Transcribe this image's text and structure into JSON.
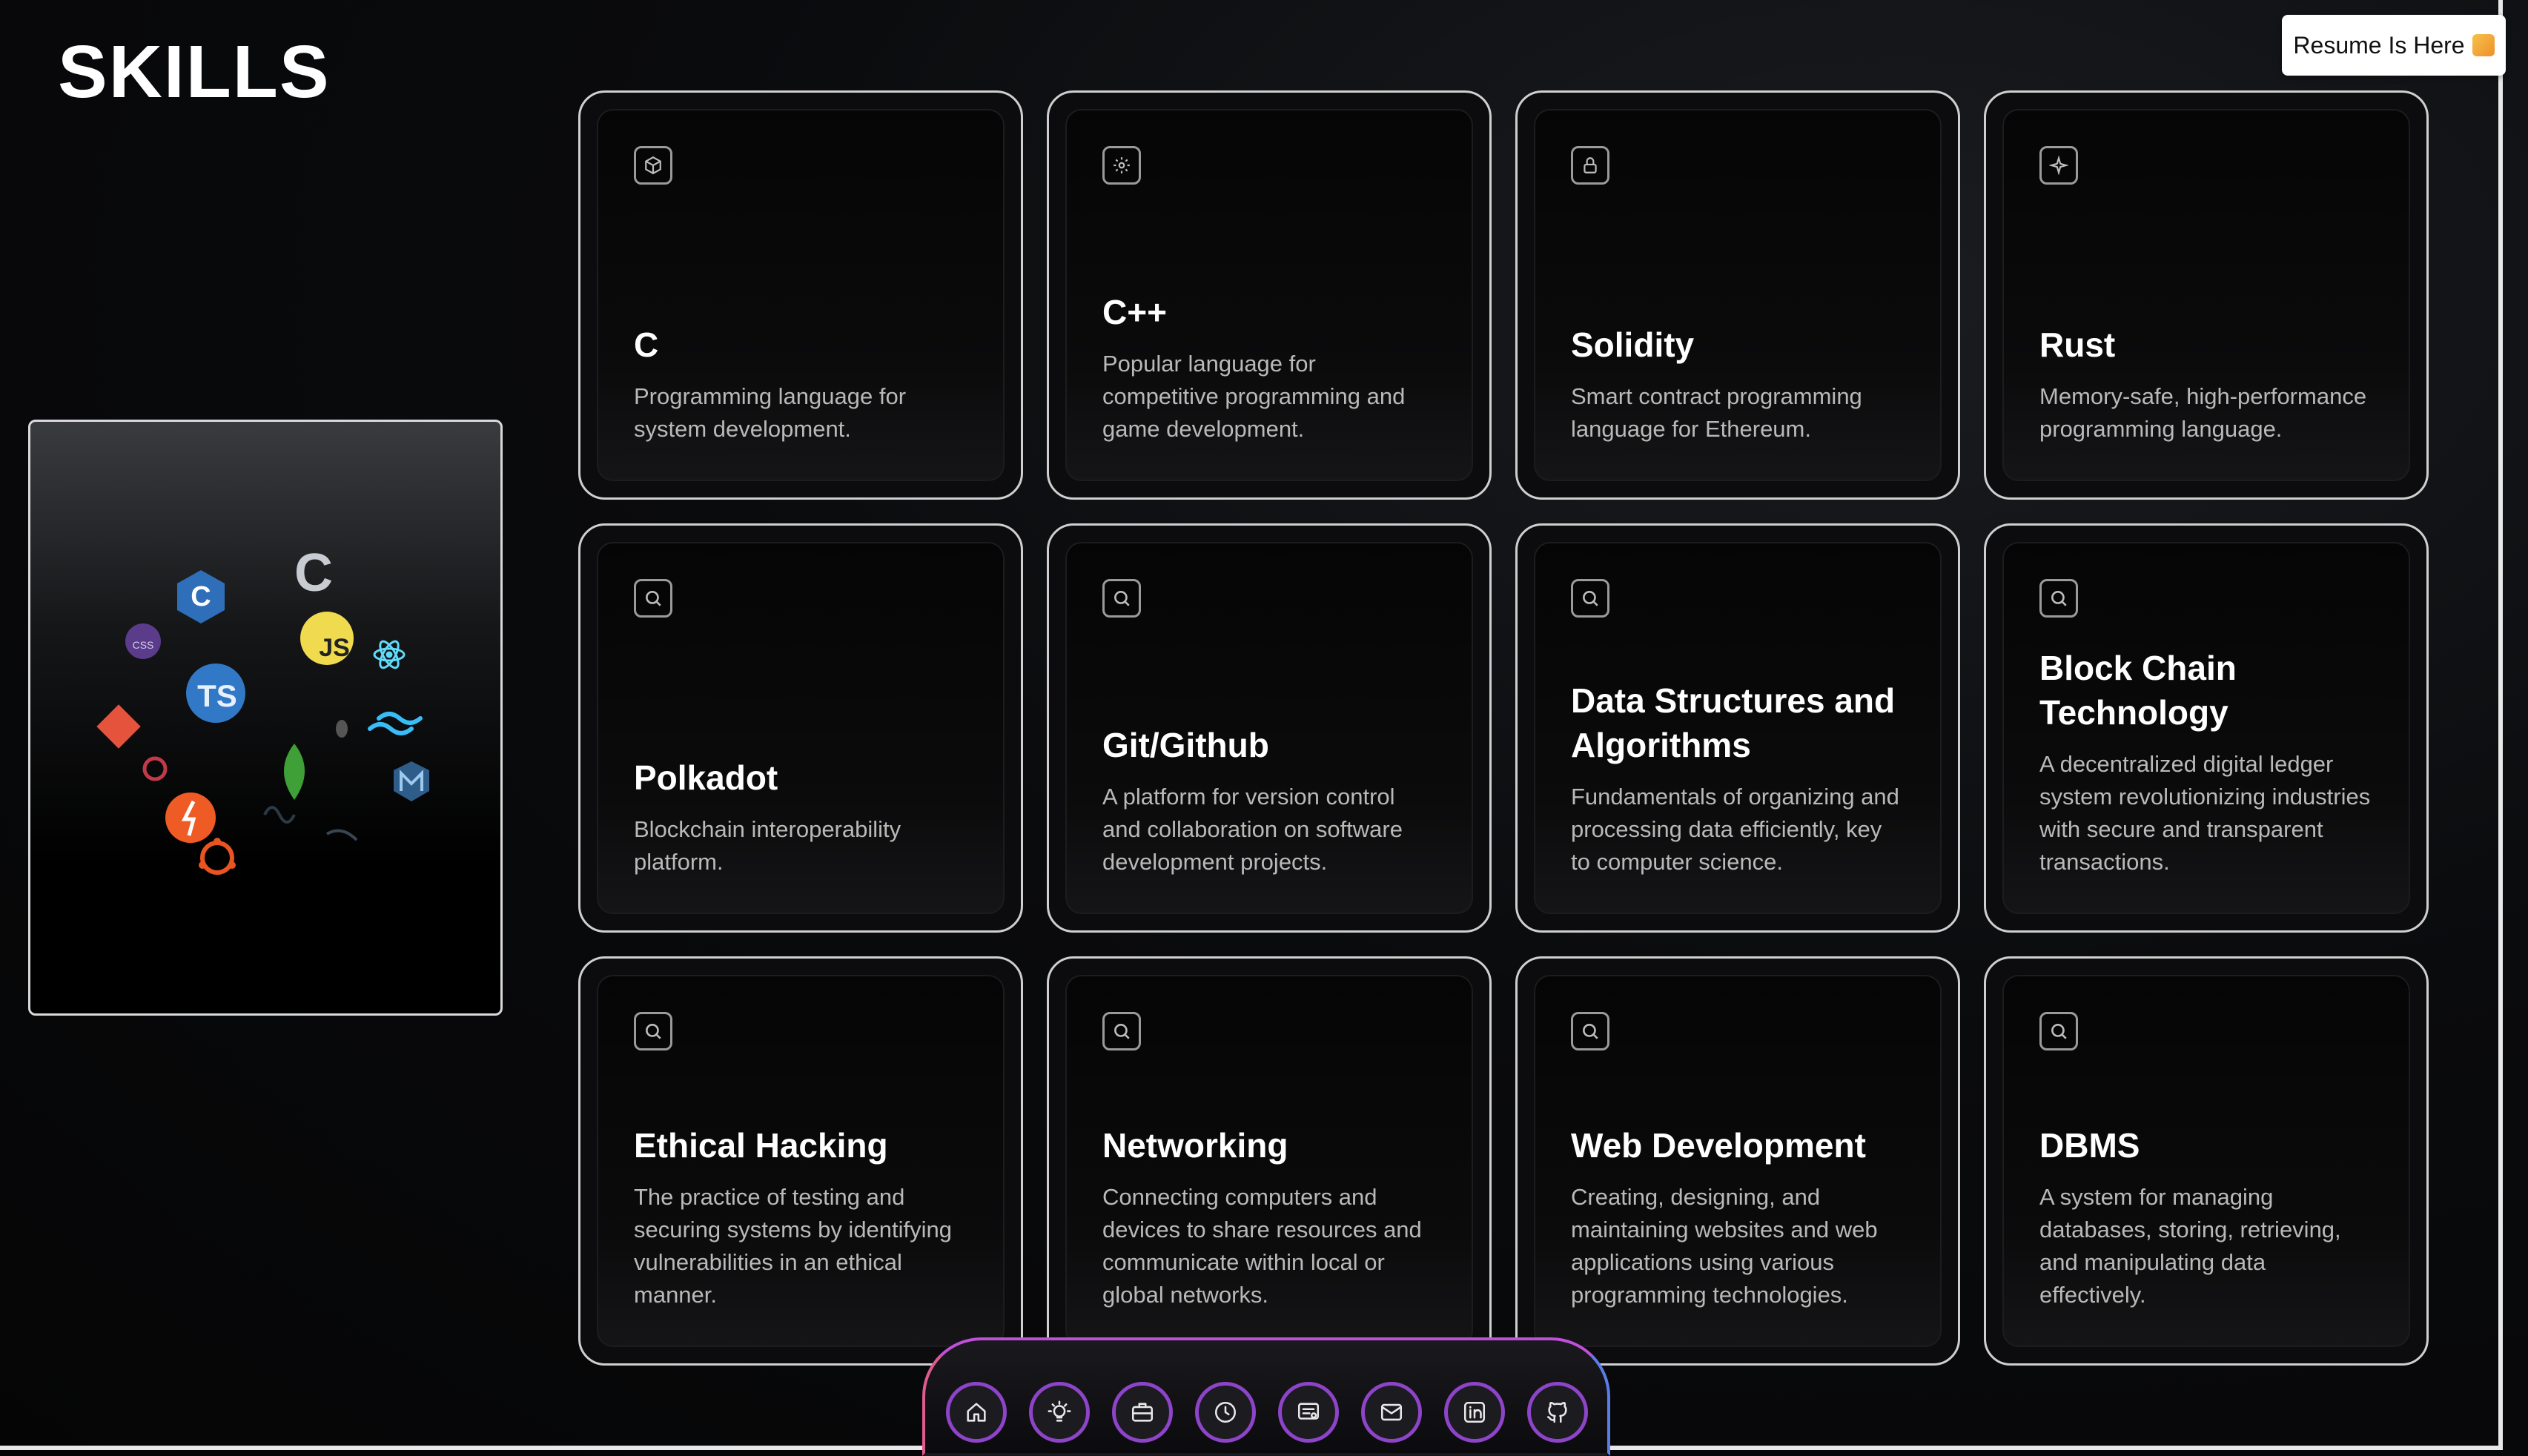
{
  "header": {
    "title": "SKILLS"
  },
  "resume_button": {
    "label": "Resume Is Here"
  },
  "skills": [
    {
      "title": "C",
      "description": "Programming language for system development.",
      "icon": "cube-icon"
    },
    {
      "title": "C++",
      "description": "Popular language for competitive programming and game development.",
      "icon": "gear-icon"
    },
    {
      "title": "Solidity",
      "description": "Smart contract programming language for Ethereum.",
      "icon": "lock-icon"
    },
    {
      "title": "Rust",
      "description": "Memory-safe, high-performance programming language.",
      "icon": "sparkle-icon"
    },
    {
      "title": "Polkadot",
      "description": "Blockchain interoperability platform.",
      "icon": "search-icon"
    },
    {
      "title": "Git/Github",
      "description": "A platform for version control and collaboration on software development projects.",
      "icon": "search-icon"
    },
    {
      "title": "Data Structures and Algorithms",
      "description": "Fundamentals of organizing and processing data efficiently, key to computer science.",
      "icon": "search-icon"
    },
    {
      "title": "Block Chain Technology",
      "description": "A decentralized digital ledger system revolutionizing industries with secure and transparent transactions.",
      "icon": "search-icon"
    },
    {
      "title": "Ethical Hacking",
      "description": "The practice of testing and securing systems by identifying vulnerabilities in an ethical manner.",
      "icon": "search-icon"
    },
    {
      "title": "Networking",
      "description": "Connecting computers and devices to share resources and communicate within local or global networks.",
      "icon": "search-icon"
    },
    {
      "title": "Web Development",
      "description": "Creating, designing, and maintaining websites and web applications using various programming technologies.",
      "icon": "search-icon"
    },
    {
      "title": "DBMS",
      "description": "A system for managing databases, storing, retrieving, and manipulating data effectively.",
      "icon": "search-icon"
    }
  ],
  "logo_cloud": {
    "labels": [
      "C",
      "JS",
      "TS",
      "CSS"
    ]
  },
  "dock": {
    "items": [
      "home-icon",
      "bulb-icon",
      "briefcase-icon",
      "clock-icon",
      "certificate-icon",
      "mail-icon",
      "linkedin-icon",
      "github-icon"
    ]
  },
  "colors": {
    "accent_purple": "#8e44c9",
    "dock_gradient": [
      "#e05a8e",
      "#c04fd9",
      "#5a7de8"
    ]
  }
}
